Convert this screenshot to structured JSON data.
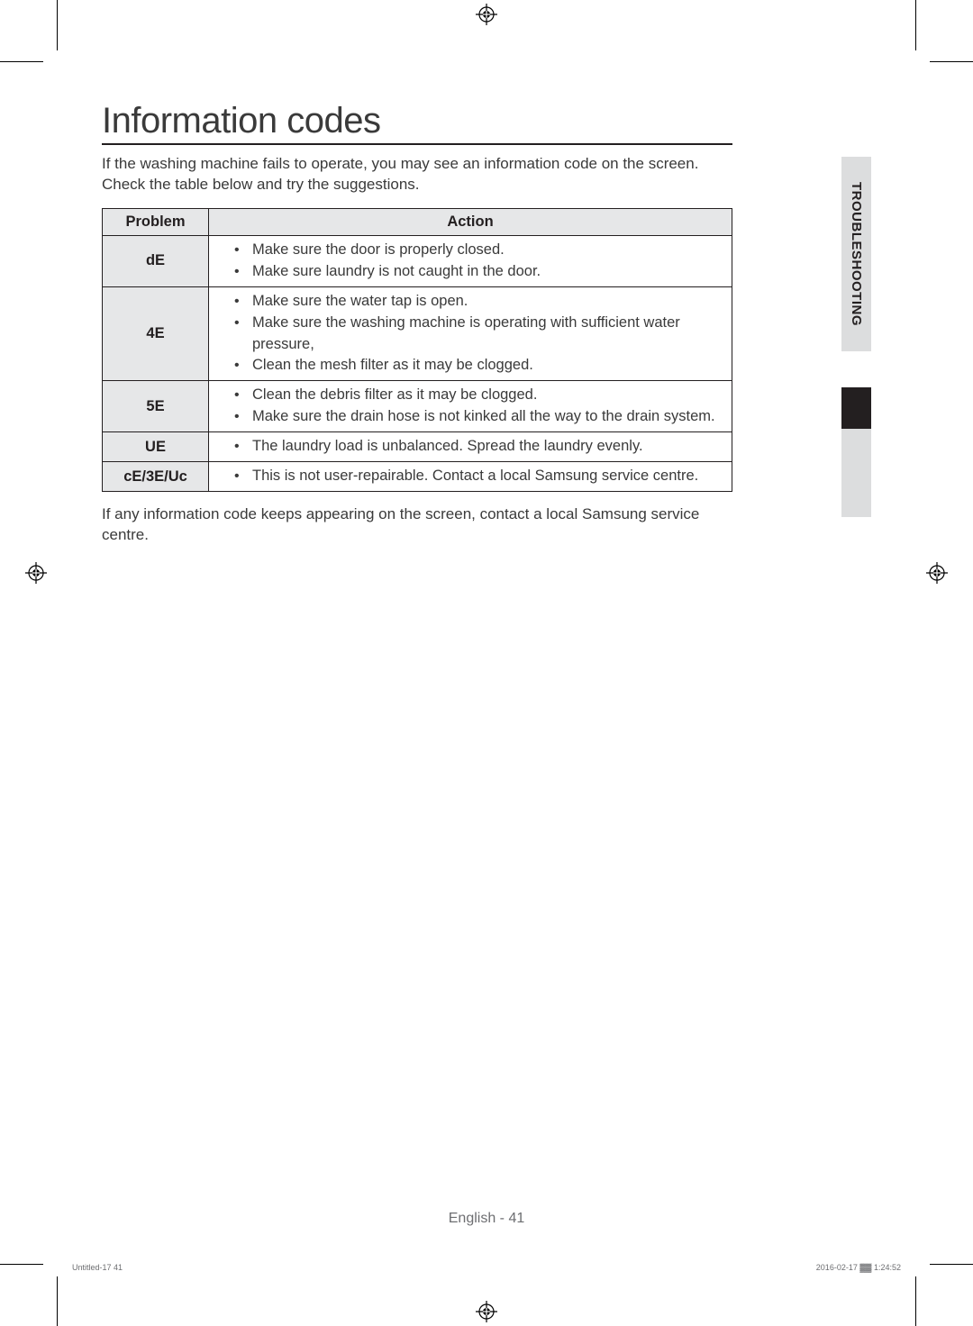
{
  "side_tab": "TROUBLESHOOTING",
  "title": "Information codes",
  "intro": "If the washing machine fails to operate, you may see an information code on the screen. Check the table below and try the suggestions.",
  "table": {
    "headers": {
      "problem": "Problem",
      "action": "Action"
    },
    "rows": [
      {
        "code": "dE",
        "actions": [
          "Make sure the door is properly closed.",
          "Make sure laundry is not caught in the door."
        ]
      },
      {
        "code": "4E",
        "actions": [
          "Make sure the water tap is open.",
          "Make sure the washing machine is operating with sufficient water pressure,",
          "Clean the mesh filter as it may be clogged."
        ]
      },
      {
        "code": "5E",
        "actions": [
          "Clean the debris filter as it may be clogged.",
          "Make sure the drain hose is not kinked all the way to the drain system."
        ]
      },
      {
        "code": "UE",
        "actions": [
          "The laundry load is unbalanced. Spread the laundry evenly."
        ]
      },
      {
        "code": "cE/3E/Uc",
        "actions": [
          "This is not user-repairable. Contact a local Samsung service centre."
        ]
      }
    ]
  },
  "outro": "If any information code keeps appearing on the screen, contact a local Samsung service centre.",
  "footer": {
    "page": "English - 41",
    "left": "Untitled-17   41",
    "right": "2016-02-17   ▓▓ 1:24:52"
  }
}
